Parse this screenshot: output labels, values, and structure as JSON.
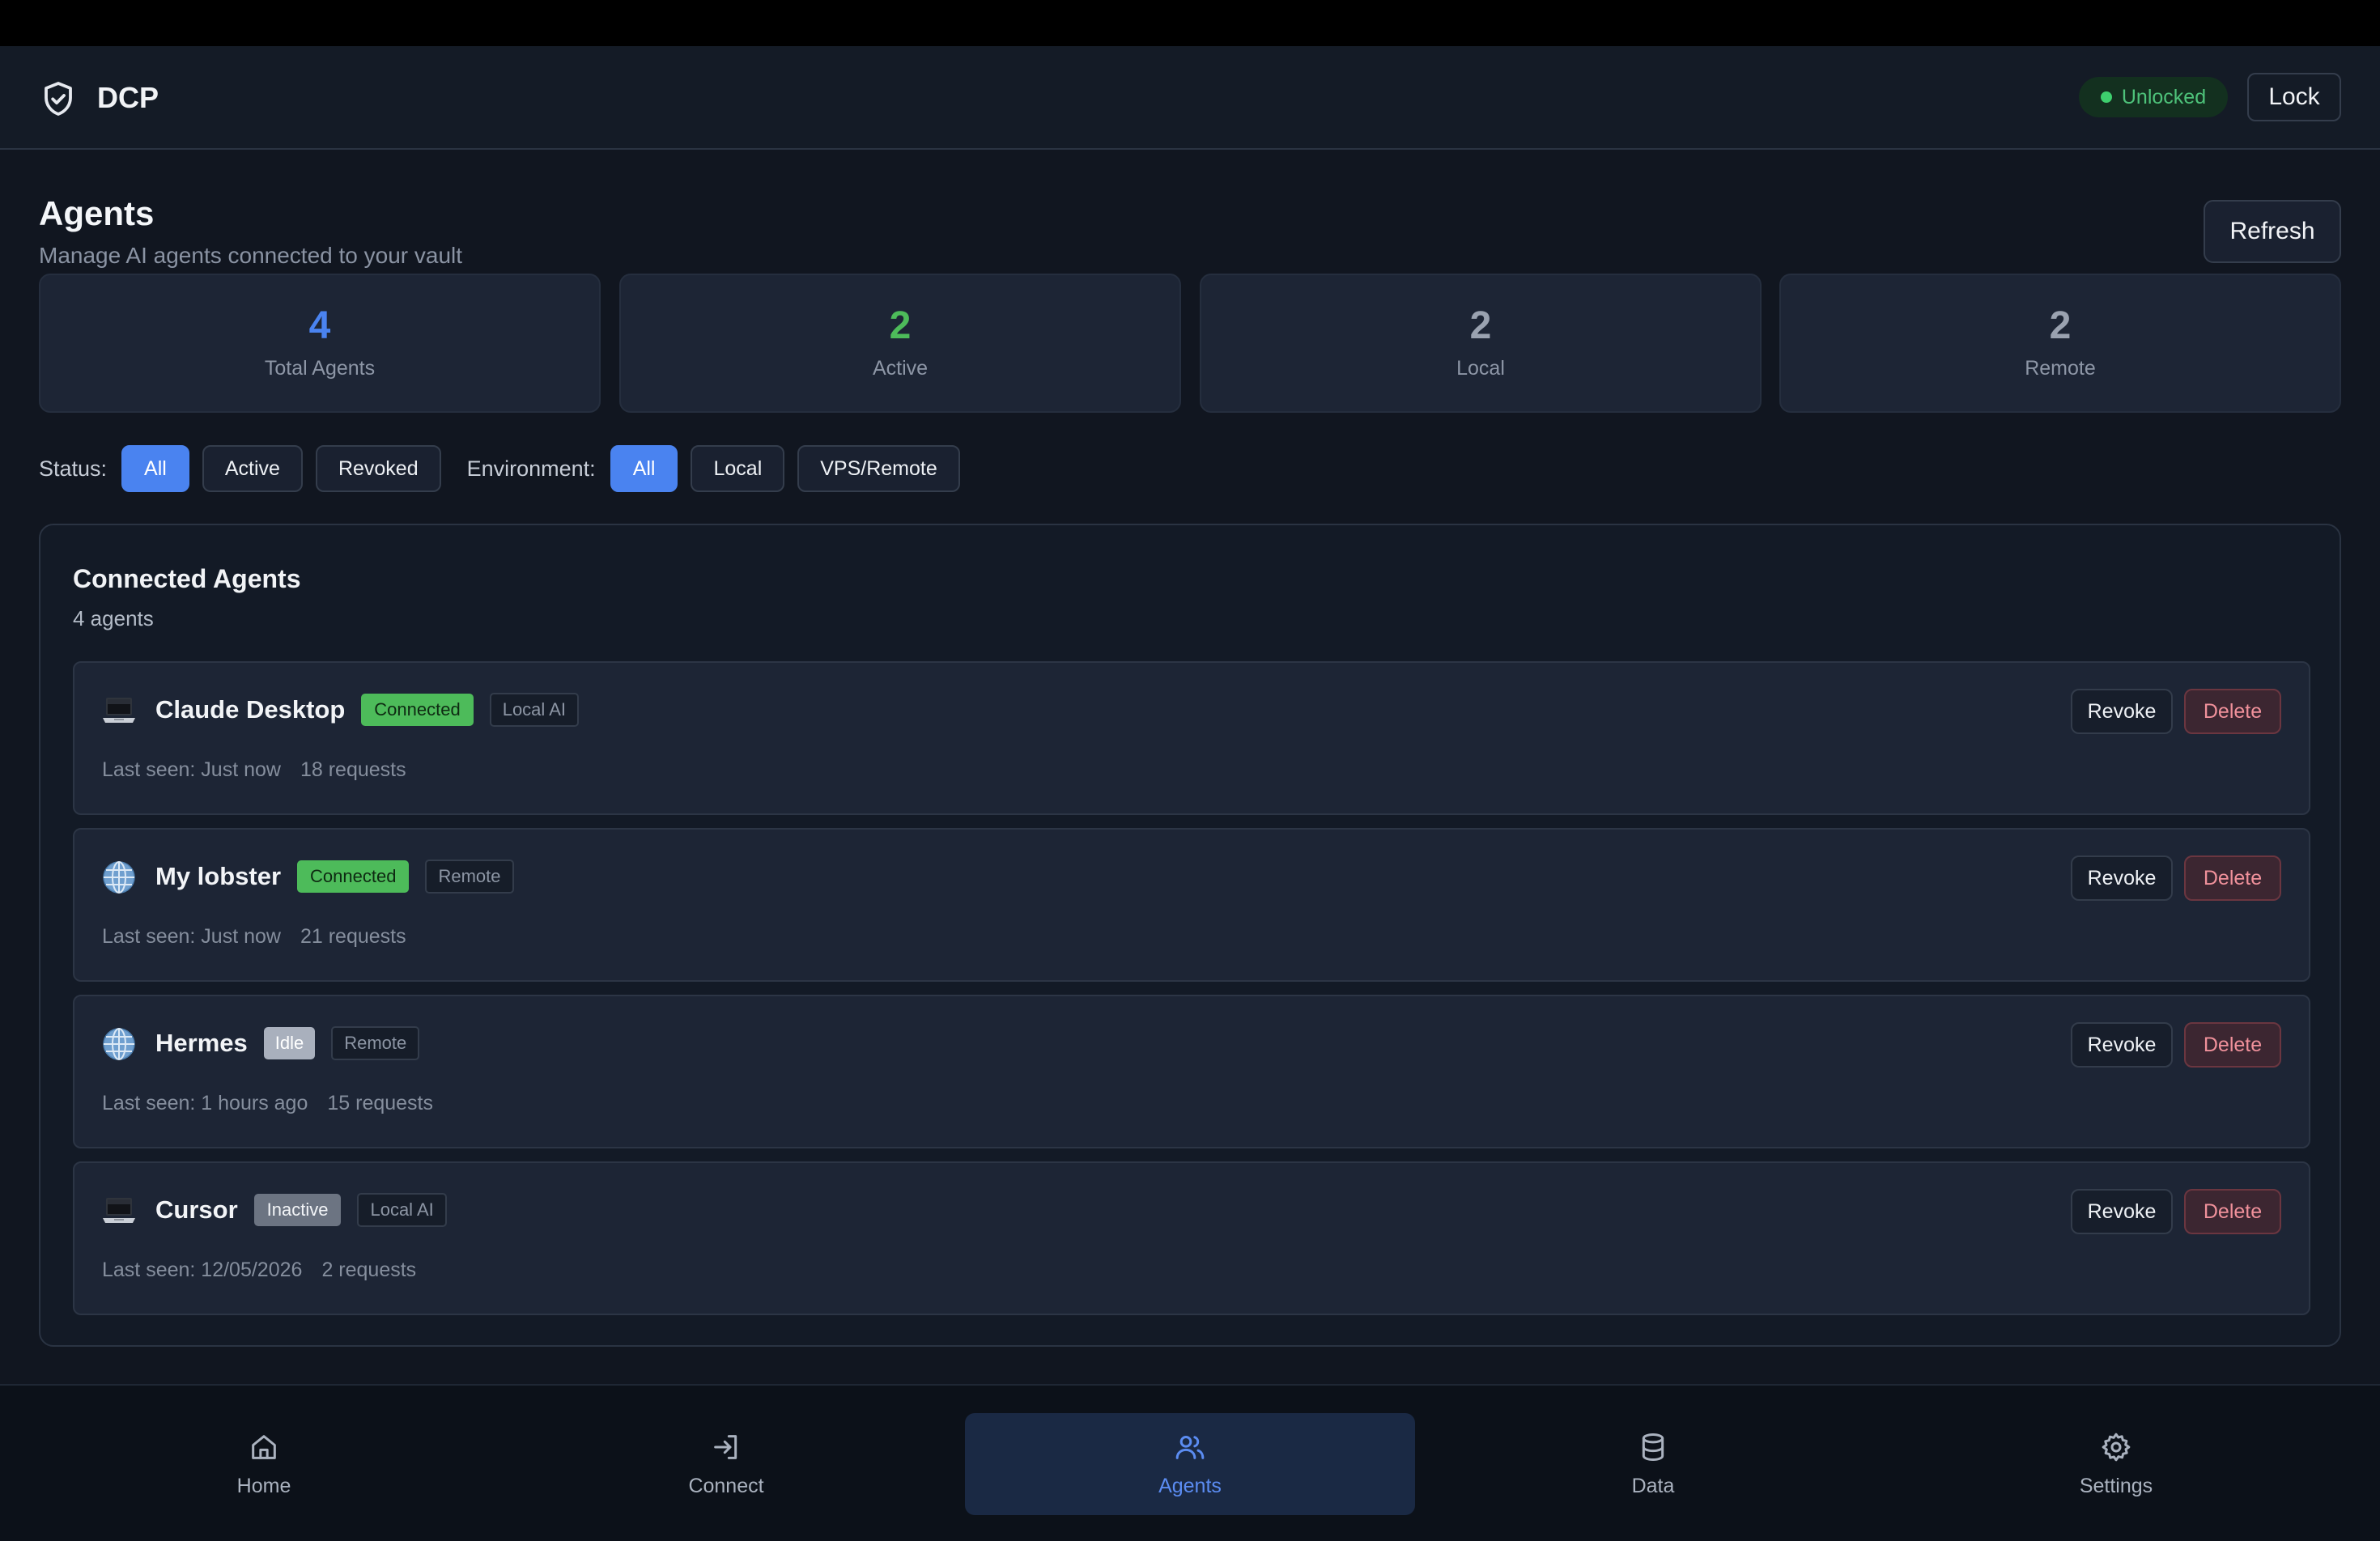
{
  "header": {
    "app_name": "DCP",
    "status_label": "Unlocked",
    "lock_label": "Lock"
  },
  "page": {
    "title": "Agents",
    "subtitle": "Manage AI agents connected to your vault",
    "refresh_label": "Refresh"
  },
  "stats": [
    {
      "value": "4",
      "label": "Total Agents",
      "color": "#4a83f0"
    },
    {
      "value": "2",
      "label": "Active",
      "color": "#4dbb5a"
    },
    {
      "value": "2",
      "label": "Local",
      "color": "#9aa2b0"
    },
    {
      "value": "2",
      "label": "Remote",
      "color": "#9aa2b0"
    }
  ],
  "filters": {
    "status_label": "Status:",
    "status_options": [
      "All",
      "Active",
      "Revoked"
    ],
    "status_selected": "All",
    "environment_label": "Environment:",
    "environment_options": [
      "All",
      "Local",
      "VPS/Remote"
    ],
    "environment_selected": "All"
  },
  "panel": {
    "title": "Connected Agents",
    "count": "4 agents",
    "revoke_label": "Revoke",
    "delete_label": "Delete"
  },
  "agents": [
    {
      "name": "Claude Desktop",
      "icon": "laptop-icon",
      "state": "Connected",
      "env": "Local AI",
      "last_seen": "Last seen: Just now",
      "requests": "18 requests"
    },
    {
      "name": "My lobster",
      "icon": "globe-icon",
      "state": "Connected",
      "env": "Remote",
      "last_seen": "Last seen: Just now",
      "requests": "21 requests"
    },
    {
      "name": "Hermes",
      "icon": "globe-icon",
      "state": "Idle",
      "env": "Remote",
      "last_seen": "Last seen: 1 hours ago",
      "requests": "15 requests"
    },
    {
      "name": "Cursor",
      "icon": "laptop-icon",
      "state": "Inactive",
      "env": "Local AI",
      "last_seen": "Last seen: 12/05/2026",
      "requests": "2 requests"
    }
  ],
  "nav": [
    {
      "label": "Home",
      "icon": "home-icon"
    },
    {
      "label": "Connect",
      "icon": "login-icon"
    },
    {
      "label": "Agents",
      "icon": "users-icon",
      "active": true
    },
    {
      "label": "Data",
      "icon": "database-icon"
    },
    {
      "label": "Settings",
      "icon": "gear-icon"
    }
  ]
}
